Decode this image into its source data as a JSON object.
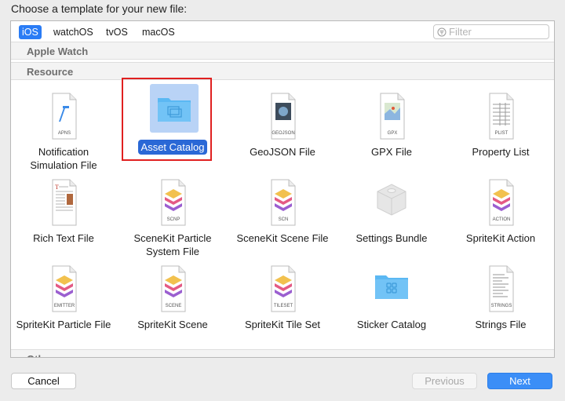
{
  "prompt": "Choose a template for your new file:",
  "platforms": [
    "iOS",
    "watchOS",
    "tvOS",
    "macOS"
  ],
  "selected_platform": "iOS",
  "filter": {
    "placeholder": "Filter",
    "value": ""
  },
  "sections": {
    "apple_watch": "Apple Watch",
    "resource": "Resource",
    "other": "Other"
  },
  "templates": [
    {
      "label": "Notification Simulation File",
      "icon": "apns-file-icon",
      "badge": "APNS"
    },
    {
      "label": "Asset Catalog",
      "icon": "asset-catalog-folder-icon",
      "selected": true
    },
    {
      "label": "GeoJSON File",
      "icon": "geojson-file-icon",
      "badge": "GEOJSON"
    },
    {
      "label": "GPX File",
      "icon": "gpx-file-icon",
      "badge": "GPX"
    },
    {
      "label": "Property List",
      "icon": "plist-file-icon",
      "badge": "PLIST"
    },
    {
      "label": "Rich Text File",
      "icon": "rich-text-file-icon"
    },
    {
      "label": "SceneKit Particle System File",
      "icon": "scnp-file-icon",
      "badge": "SCNP"
    },
    {
      "label": "SceneKit Scene File",
      "icon": "scn-file-icon",
      "badge": "SCN"
    },
    {
      "label": "Settings Bundle",
      "icon": "settings-bundle-icon"
    },
    {
      "label": "SpriteKit Action",
      "icon": "spritekit-action-icon",
      "badge": "ACTION"
    },
    {
      "label": "SpriteKit Particle File",
      "icon": "spritekit-emitter-icon",
      "badge": "EMITTER"
    },
    {
      "label": "SpriteKit Scene",
      "icon": "spritekit-scene-icon",
      "badge": "SCENE"
    },
    {
      "label": "SpriteKit Tile Set",
      "icon": "spritekit-tileset-icon",
      "badge": "TILESET"
    },
    {
      "label": "Sticker Catalog",
      "icon": "sticker-catalog-folder-icon"
    },
    {
      "label": "Strings File",
      "icon": "strings-file-icon",
      "badge": "STRINGS"
    }
  ],
  "buttons": {
    "cancel": "Cancel",
    "previous": "Previous",
    "next": "Next"
  },
  "colors": {
    "accent": "#2a7cf5",
    "selection": "#2a68d6",
    "folder": "#5bb8f3"
  }
}
